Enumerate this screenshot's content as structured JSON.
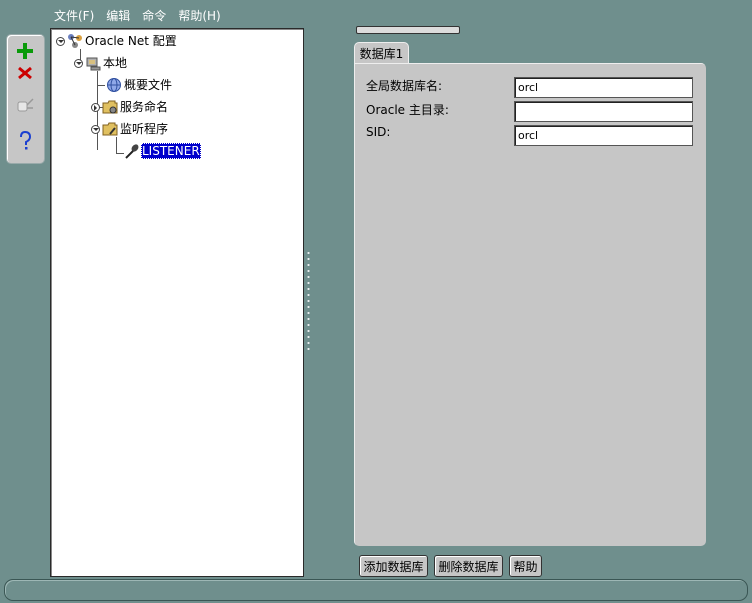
{
  "menu": {
    "file": "文件(F)",
    "edit": "编辑",
    "command": "命令",
    "help": "帮助(H)"
  },
  "toolbar": {
    "add_icon": "plus-icon",
    "delete_icon": "close-icon",
    "test_icon": "test-connection-icon",
    "help_icon": "help-icon"
  },
  "tree": {
    "root": "Oracle Net 配置",
    "local": "本地",
    "profile": "概要文件",
    "naming": "服务命名",
    "listeners": "监听程序",
    "listener": "LISTENER"
  },
  "tab": {
    "label": "数据库1"
  },
  "form": {
    "global_db_name_label": "全局数据库名:",
    "global_db_name_value": "orcl",
    "oracle_home_label": "Oracle 主目录:",
    "oracle_home_value": "",
    "sid_label": "SID:",
    "sid_value": "orcl"
  },
  "buttons": {
    "add_db": "添加数据库",
    "delete_db": "删除数据库",
    "help": "帮助"
  },
  "colors": {
    "background": "#6f8f8d",
    "selection": "#0000cc",
    "panel": "#c6c6c6"
  }
}
